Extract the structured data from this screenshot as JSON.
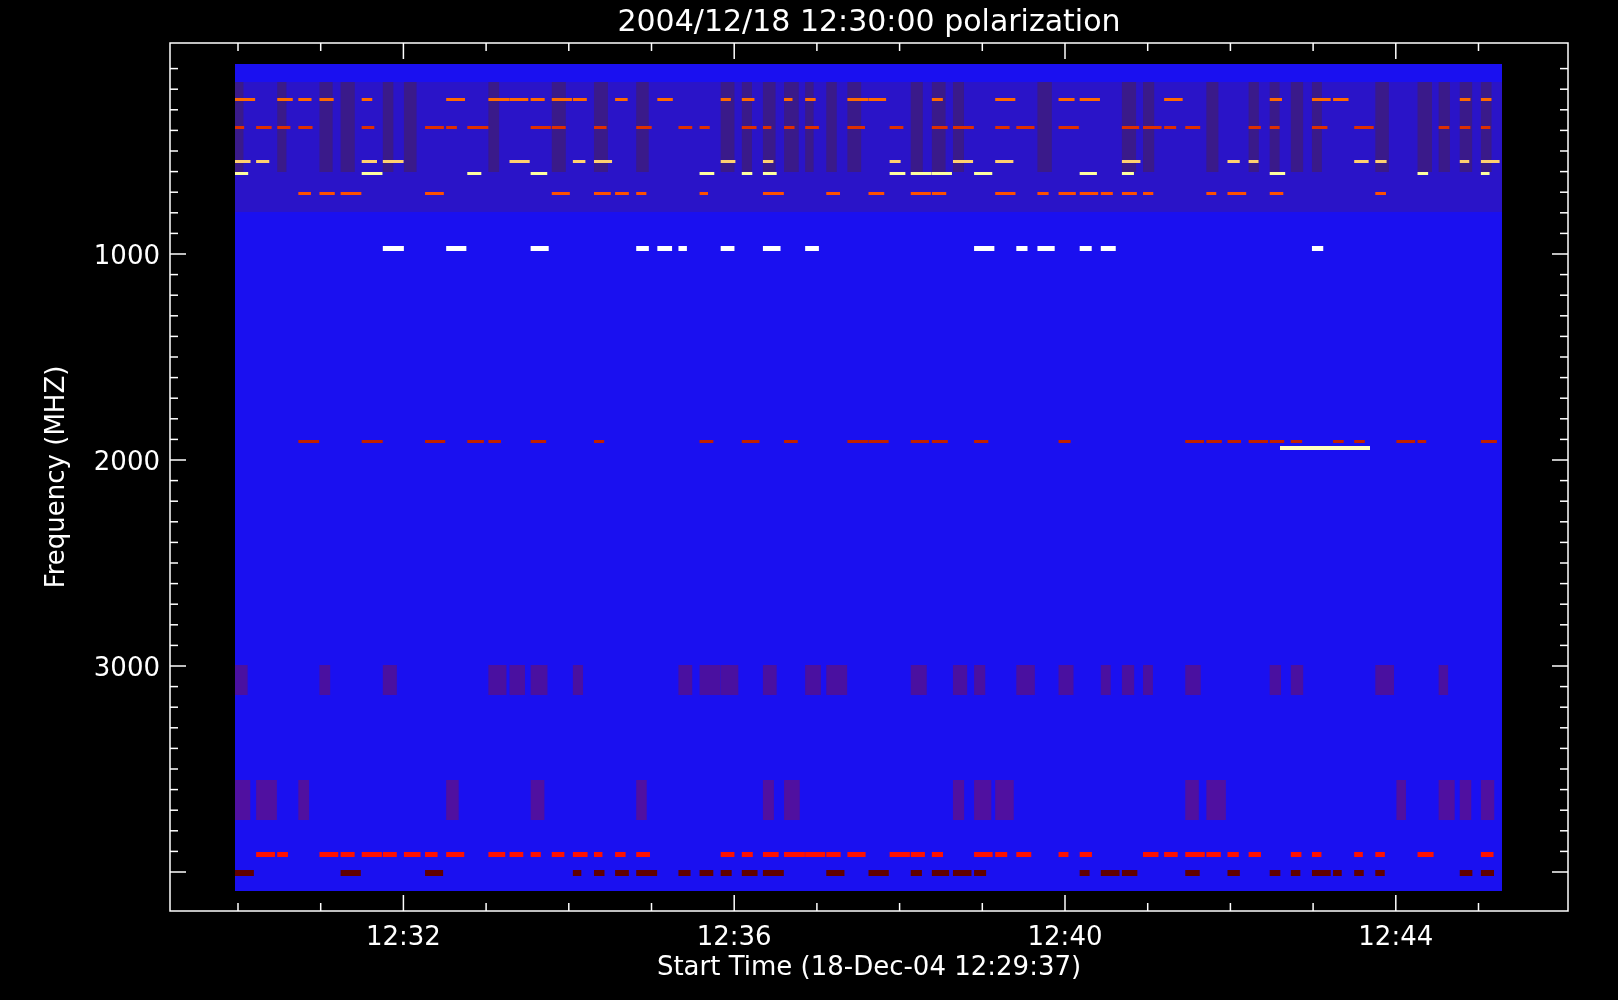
{
  "title": "2004/12/18 12:30:00 polarization",
  "y_axis": {
    "label": "Frequency (MHZ)",
    "ticks": [
      "1000",
      "2000",
      "3000"
    ]
  },
  "x_axis": {
    "label": "Start Time (18-Dec-04 12:29:37)",
    "ticks": [
      "12:32",
      "12:36",
      "12:40",
      "12:44"
    ]
  }
}
